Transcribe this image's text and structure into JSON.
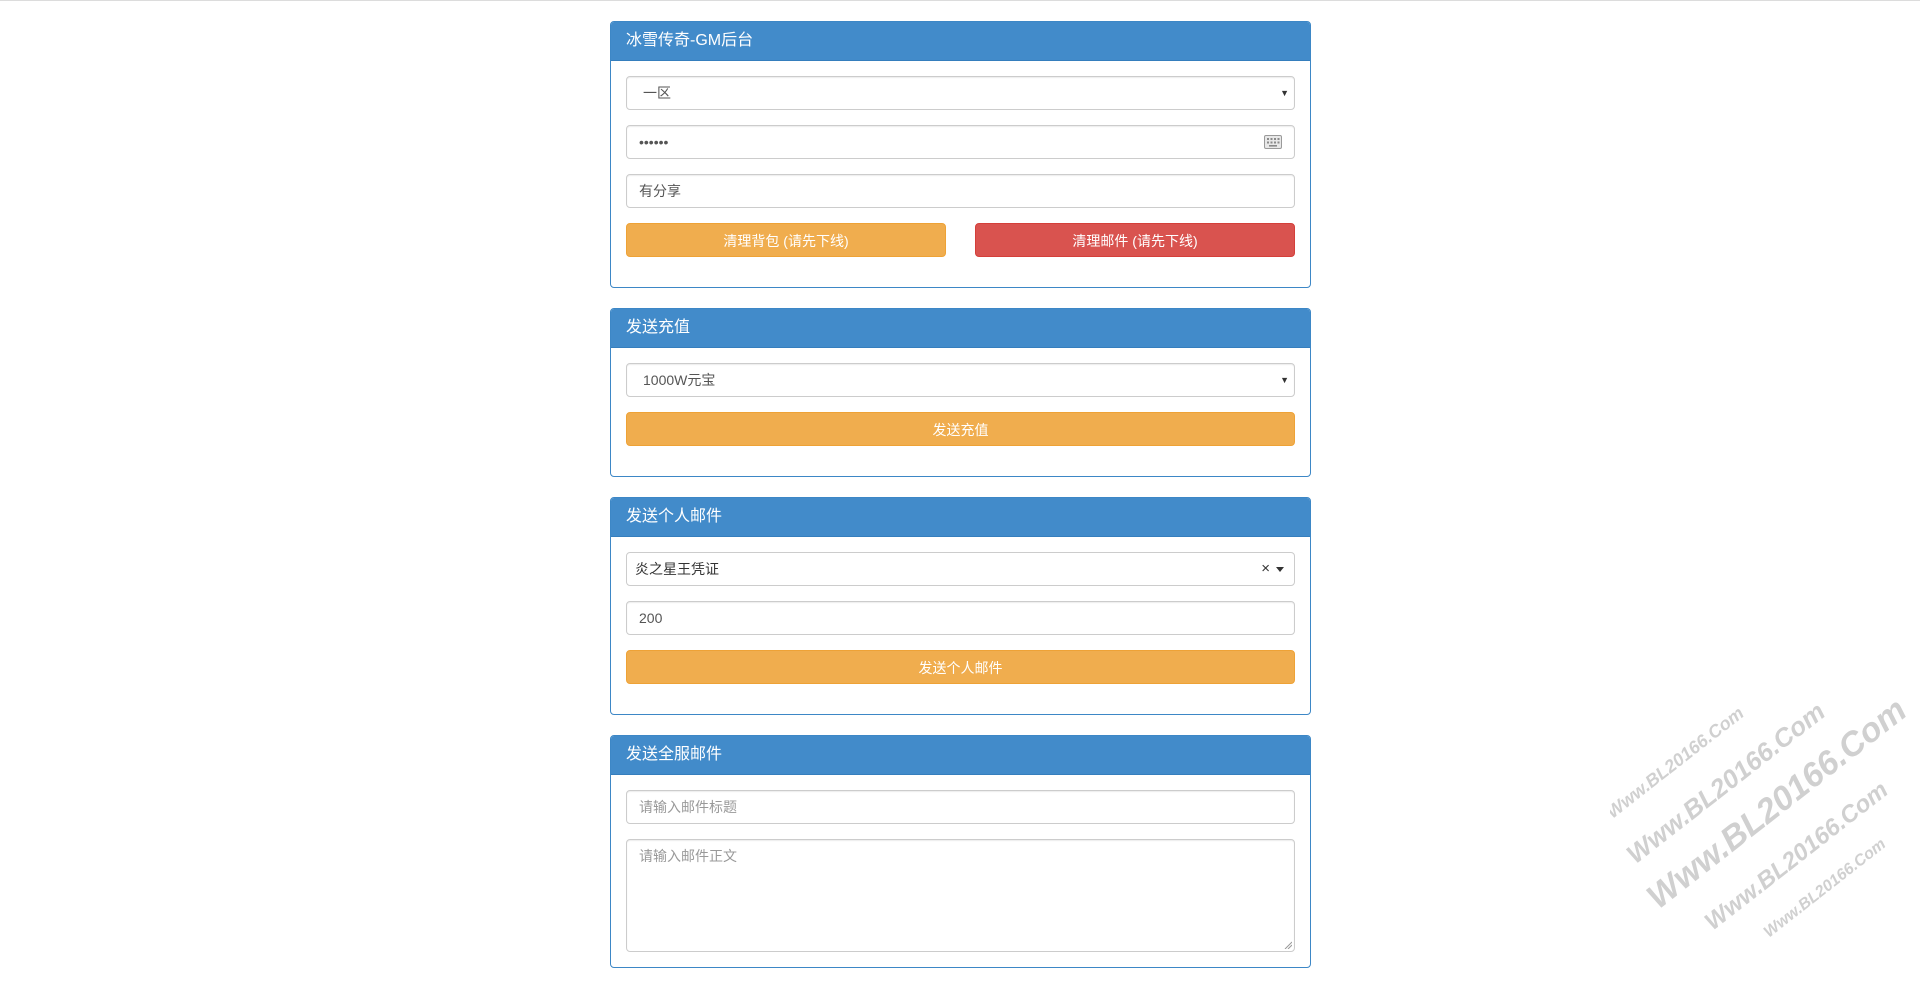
{
  "panel_main": {
    "title": "冰雪传奇-GM后台",
    "server_select": "一区",
    "password_value": "••••••",
    "player_name_value": "有分享",
    "clear_bag_label": "清理背包 (请先下线)",
    "clear_mail_label": "清理邮件 (请先下线)"
  },
  "panel_recharge": {
    "title": "发送充值",
    "amount_select": "1000W元宝",
    "send_label": "发送充值"
  },
  "panel_personal_mail": {
    "title": "发送个人邮件",
    "item_select": "炎之星王凭证",
    "clear_symbol": "×",
    "quantity_value": "200",
    "send_label": "发送个人邮件"
  },
  "panel_global_mail": {
    "title": "发送全服邮件",
    "subject_placeholder": "请输入邮件标题",
    "body_placeholder": "请输入邮件正文"
  },
  "watermark": {
    "lines": [
      "Www.BL20166.Com",
      "Www.BL20166.Com",
      "Www.BL20166.Com",
      "Www.BL20166.Com",
      "Www.BL20166.Com"
    ]
  },
  "colors": {
    "panel_heading": "#428bca",
    "warning": "#f0ad4e",
    "danger": "#d9534f"
  },
  "icons": {
    "keyboard": "keyboard-icon",
    "select_caret": "caret-down-icon",
    "clear": "close-icon",
    "resize": "resize-grip-icon"
  }
}
